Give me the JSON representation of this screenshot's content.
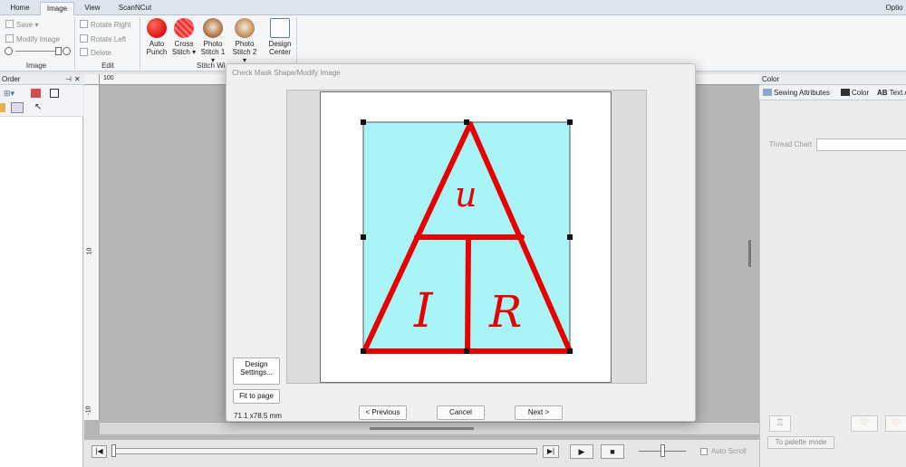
{
  "ribbon": {
    "tabs": [
      "Home",
      "Image",
      "View",
      "ScanNCut"
    ],
    "active_tab": "Image",
    "right_tab": "Optio",
    "image_group": {
      "save_label": "Save",
      "modify_label": "Modify Image",
      "group_label": "Image"
    },
    "edit_group": {
      "rotate_right": "Rotate Right",
      "rotate_left": "Rotate Left",
      "delete": "Delete",
      "group_label": "Edit"
    },
    "stitch_group": {
      "buttons": [
        {
          "line1": "Auto",
          "line2": "Punch"
        },
        {
          "line1": "Cross",
          "line2": "Stitch"
        },
        {
          "line1": "Photo",
          "line2": "Stitch 1"
        },
        {
          "line1": "Photo",
          "line2": "Stitch 2"
        },
        {
          "line1": "Design",
          "line2": "Center"
        }
      ],
      "group_label": "Stitch Wi"
    }
  },
  "left_panel": {
    "title": "Order"
  },
  "ruler": {
    "top_label": "100",
    "left_labels": [
      "10",
      "-10"
    ]
  },
  "right_panel": {
    "title": "Color",
    "tabs": [
      "Sewing Attributes",
      "Color",
      "Text A"
    ],
    "tab_icon_prefix": "AB",
    "thread_chart_label": "Thread Chart",
    "palette_button": "To palette mode"
  },
  "playback": {
    "auto_scroll_label": "Auto Scroll"
  },
  "dialog": {
    "title": "Check Mask Shape/Modify Image",
    "design_settings_line1": "Design",
    "design_settings_line2": "Settings...",
    "fit_to_page": "Fit to page",
    "dimensions": "71.1 x78.5 mm",
    "previous": "< Previous",
    "cancel": "Cancel",
    "next": "Next >",
    "image_text": {
      "top": "u",
      "left": "I",
      "right": "R"
    }
  },
  "colors": {
    "mask_fill": "#a9f4f7",
    "stroke_red": "#e60000",
    "accent": "#4a7ab5"
  }
}
